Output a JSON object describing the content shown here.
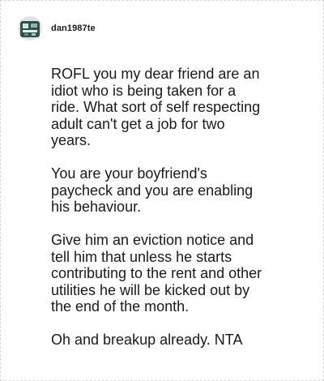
{
  "post": {
    "username": "dan1987te",
    "avatar_icon": "user-avatar-icon",
    "paragraphs": [
      "ROFL you my dear friend are an\nidiot who is being taken for a\nride. What sort of self respecting\nadult can't get a job for two\nyears.",
      "You are your boyfriend's\npaycheck and you are enabling\nhis behaviour.",
      "Give him an eviction notice and\ntell him that unless he starts\ncontributing to the rent and other\nutilities he will be kicked out by\nthe end of the month.",
      "Oh and breakup already. NTA"
    ]
  }
}
